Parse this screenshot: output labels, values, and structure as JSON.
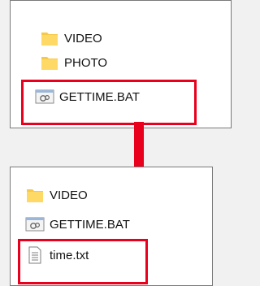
{
  "before": {
    "items": [
      {
        "label": "VIDEO",
        "icon": "folder-icon"
      },
      {
        "label": "PHOTO",
        "icon": "folder-icon"
      },
      {
        "label": "GETTIME.BAT",
        "icon": "batch-file-icon"
      }
    ]
  },
  "after": {
    "items": [
      {
        "label": "VIDEO",
        "icon": "folder-icon"
      },
      {
        "label": "GETTIME.BAT",
        "icon": "batch-file-icon"
      },
      {
        "label": "time.txt",
        "icon": "text-file-icon"
      }
    ]
  },
  "colors": {
    "highlight": "#e8001c",
    "folder": "#f7c948",
    "background": "#f1f1f1"
  }
}
